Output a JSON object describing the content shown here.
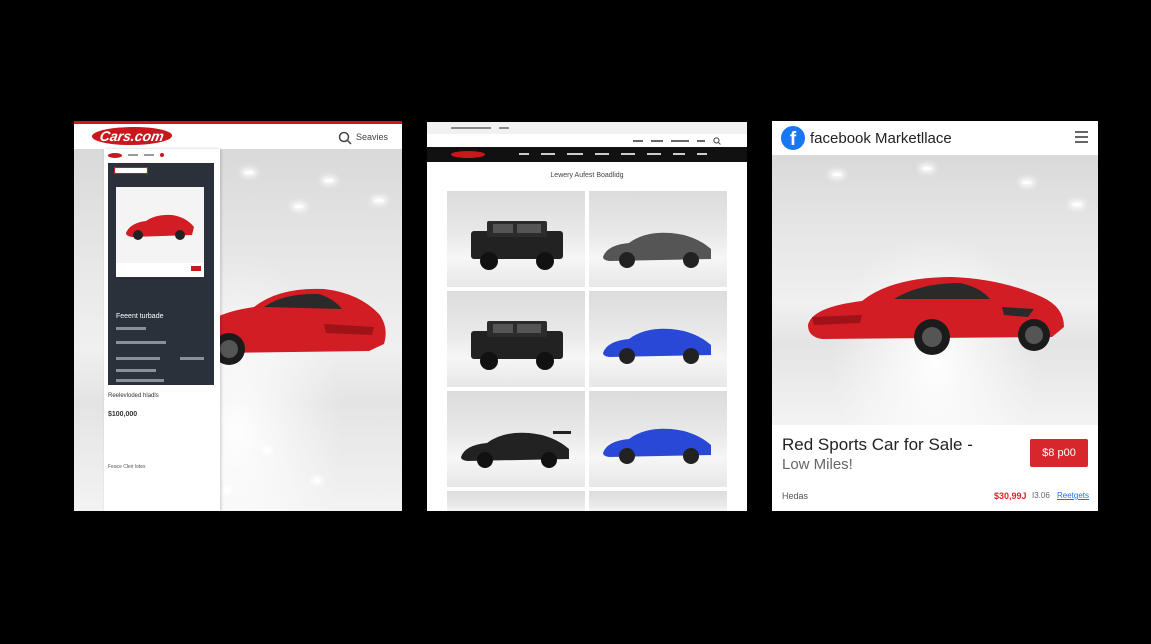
{
  "panels": {
    "cars": {
      "logo": "Cars.com",
      "search_label": "Seavies",
      "card_title": "Feeent turbade",
      "below_title": "Reelevloded hladls",
      "price": "$100,000",
      "footer_text": "Feace Cleir lotes"
    },
    "listings": {
      "heading": "Lewery Aufest Boadlidg"
    },
    "facebook": {
      "logo_letter": "f",
      "title": "facebook Marketllace",
      "listing_title_line1": "Red Sports Car for Sale -",
      "listing_title_line2": "Low Miles!",
      "price_button": "$8 p00",
      "location": "Hedas",
      "price_secondary": "$30,99J",
      "extra_text": "I3.06",
      "link_text": "Reetgets"
    }
  },
  "colors": {
    "cars_red": "#c8171d",
    "facebook_blue": "#1877f2",
    "price_red": "#d7262c",
    "car_red": "#d21d25",
    "car_blue": "#2a48d6",
    "car_black": "#222222",
    "car_gray": "#555555"
  },
  "icons": [
    "search-icon",
    "menu-icon",
    "facebook-logo-icon"
  ]
}
